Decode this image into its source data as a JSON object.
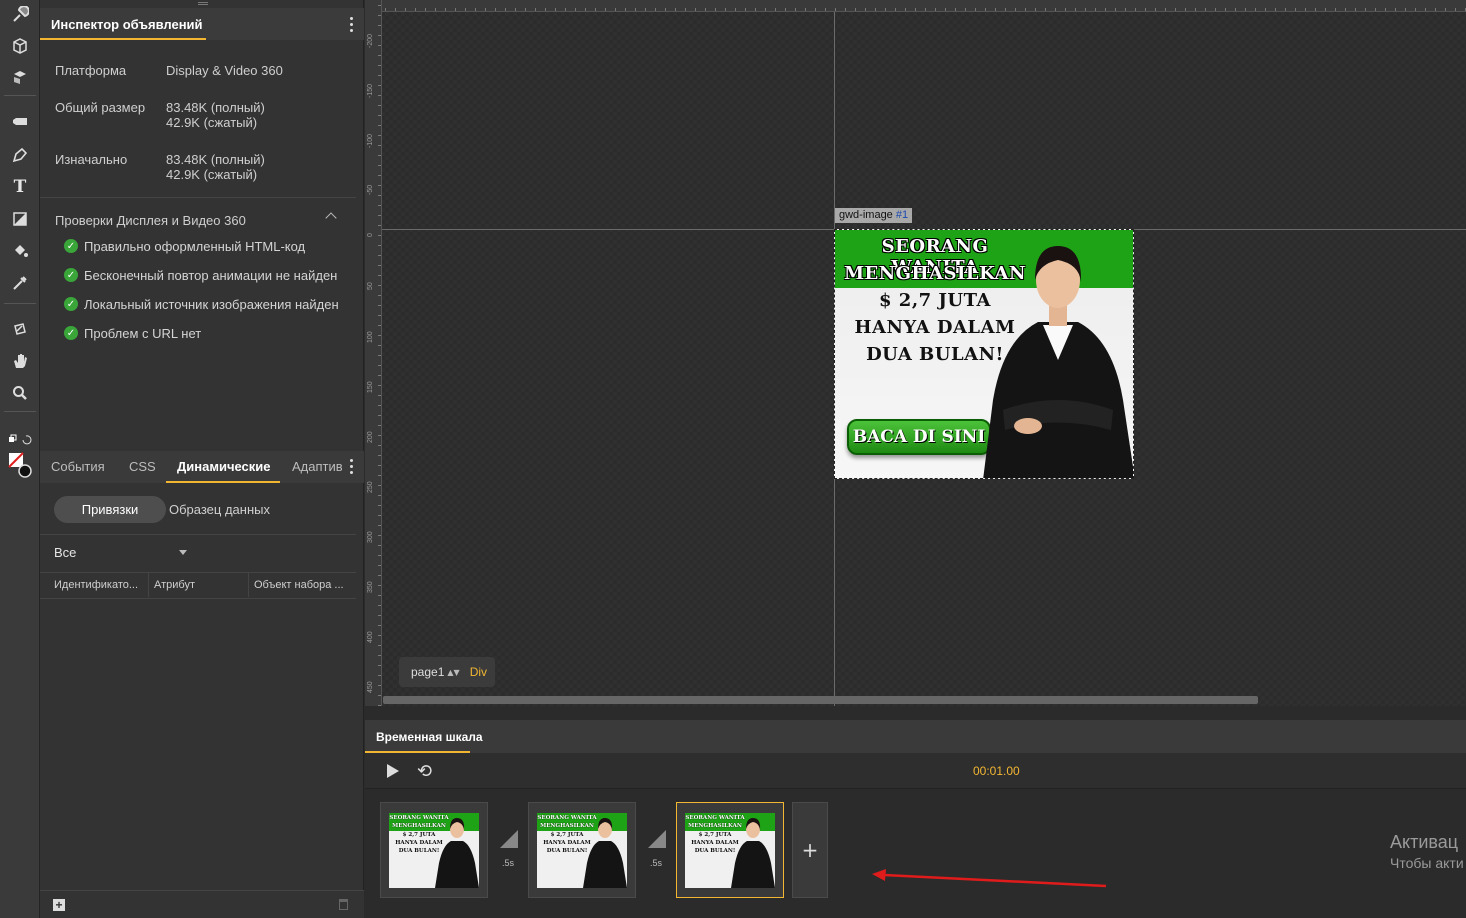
{
  "toolbar": {
    "tools": [
      "brush-tool-icon",
      "3d-object-icon",
      "3d-rotate-icon",
      "tag-tool-icon",
      "pen-tool-icon",
      "text-tool-icon",
      "shape-tool-icon",
      "fill-tool-icon",
      "eyedropper-icon",
      "3d-translate-icon",
      "hand-tool-icon",
      "zoom-icon",
      "swap-colors-icon",
      "color-swatch-icon"
    ],
    "text_tool_glyph": "T"
  },
  "inspector": {
    "title": "Инспектор объявлений",
    "rows": [
      {
        "label": "Платформа",
        "value1": "Display & Video 360",
        "value2": ""
      },
      {
        "label": "Общий размер",
        "value1": "83.48K (полный)",
        "value2": "42.9K (сжатый)"
      },
      {
        "label": "Изначально",
        "value1": "83.48K (полный)",
        "value2": "42.9K (сжатый)"
      }
    ],
    "checks_title": "Проверки Дисплея и Видео 360",
    "checks": [
      "Правильно оформленный HTML-код",
      "Бесконечный повтор анимации не найден",
      "Локальный источник изображения найден",
      "Проблем с URL нет"
    ],
    "check_mark": "✓"
  },
  "lower_panel": {
    "tabs": [
      "События",
      "CSS",
      "Динамические",
      "Адаптив"
    ],
    "active_tab": "Динамические",
    "pill_active": "Привязки",
    "pill_other": "Образец данных",
    "filter": "Все",
    "columns": [
      "Идентификато...",
      "Атрибут",
      "Объект набора ..."
    ],
    "add_glyph": "+"
  },
  "stage": {
    "tag_name": "gwd-image",
    "tag_num": "#1",
    "ruler_left_ticks": [
      "-200",
      "-150",
      "-100",
      "-50",
      "0",
      "50",
      "100",
      "150",
      "200",
      "250",
      "300",
      "350",
      "400",
      "450"
    ],
    "ad": {
      "lines": [
        "SEORANG WANITA",
        "MENGHASILKAN",
        "$ 2,7 JUTA",
        "HANYA DALAM",
        "DUA BULAN!"
      ],
      "button": "BACA DI SINI"
    },
    "page": "page1",
    "page_arrows": "▲▼",
    "element": "Div"
  },
  "timeline": {
    "tab": "Временная шкала",
    "loop_glyph": "⟲",
    "time": "00:01.00",
    "transitions": [
      ".5s",
      ".5s"
    ],
    "add_glyph": "+",
    "thumb_lines": [
      "SEORANG WANITA",
      "MENGHASILKAN",
      "$ 2,7 JUTA",
      "HANYA DALAM",
      "DUA BULAN!"
    ]
  },
  "watermark": {
    "line1": "Активац",
    "line2": "Чтобы акти"
  },
  "colors": {
    "accent": "#f2b632",
    "check_green": "#3aa63a",
    "ad_green": "#1fa316",
    "annotation_arrow": "#e01b1b"
  }
}
